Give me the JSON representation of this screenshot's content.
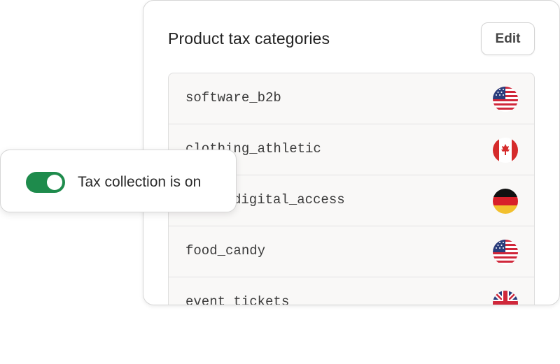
{
  "panel": {
    "title": "Product tax categories",
    "edit_label": "Edit"
  },
  "categories": [
    {
      "label": "software_b2b",
      "flag": "us-flag-icon"
    },
    {
      "label": "clothing_athletic",
      "flag": "canada-flag-icon"
    },
    {
      "label": "digital_access",
      "flag": "germany-flag-icon"
    },
    {
      "label": "food_candy",
      "flag": "us-flag-icon"
    },
    {
      "label": "event_tickets",
      "flag": "uk-flag-icon"
    }
  ],
  "toggle": {
    "label": "Tax collection is on",
    "state": "on",
    "color": "#1e8b4c"
  }
}
